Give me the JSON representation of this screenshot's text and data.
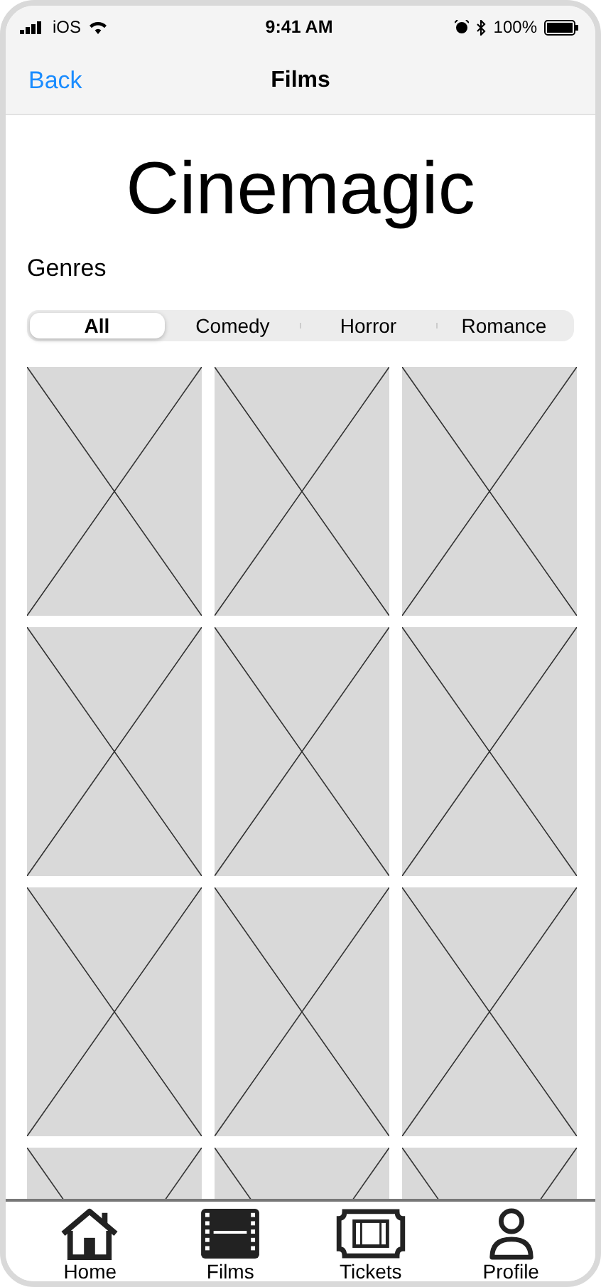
{
  "status_bar": {
    "carrier": "iOS",
    "time": "9:41 AM",
    "battery": "100%"
  },
  "nav_bar": {
    "back": "Back",
    "title": "Films"
  },
  "heading": "Cinemagic",
  "section_label": "Genres",
  "genres": [
    {
      "label": "All",
      "selected": true
    },
    {
      "label": "Comedy",
      "selected": false
    },
    {
      "label": "Horror",
      "selected": false
    },
    {
      "label": "Romance",
      "selected": false
    }
  ],
  "posters": [
    {
      "kind": "placeholder"
    },
    {
      "kind": "placeholder"
    },
    {
      "kind": "placeholder"
    },
    {
      "kind": "placeholder"
    },
    {
      "kind": "placeholder"
    },
    {
      "kind": "placeholder"
    },
    {
      "kind": "placeholder"
    },
    {
      "kind": "placeholder"
    },
    {
      "kind": "placeholder"
    },
    {
      "kind": "placeholder"
    },
    {
      "kind": "placeholder"
    },
    {
      "kind": "placeholder"
    }
  ],
  "tab_bar": [
    {
      "label": "Home"
    },
    {
      "label": "Films"
    },
    {
      "label": "Tickets"
    },
    {
      "label": "Profile"
    }
  ]
}
